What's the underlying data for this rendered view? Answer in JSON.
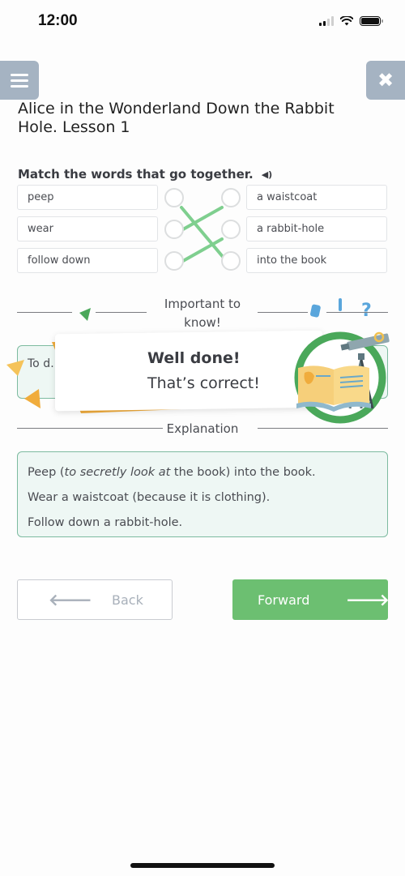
{
  "status_bar": {
    "time": "12:00",
    "signal_bars": "2 of 4",
    "icons": [
      "signal-icon",
      "wifi-icon",
      "battery-icon"
    ]
  },
  "header": {
    "menu_icon": "hamburger-menu-icon",
    "close_icon": "close-icon",
    "title": "Alice in the Wonderland Down the Rabbit Hole. Lesson 1"
  },
  "exercise": {
    "instruction": "Match the words that go together.",
    "audio_icon": "speaker-icon",
    "left_items": [
      "peep",
      "wear",
      "follow down"
    ],
    "right_items": [
      "a waistcoat",
      "a rabbit-hole",
      "into the book"
    ],
    "matches": [
      {
        "left": "peep",
        "right": "into the book"
      },
      {
        "left": "wear",
        "right": "a waistcoat"
      },
      {
        "left": "follow down",
        "right": "a rabbit-hole"
      }
    ],
    "line_color": "#7fcf8f"
  },
  "important": {
    "label": "Important to know!",
    "hint_text_visible": "To d… mean…"
  },
  "feedback": {
    "title": "Well done!",
    "subtitle": "That’s correct!",
    "ribbon_color": "#f0ac3c",
    "ring_color": "#4aa85a"
  },
  "explanation": {
    "label": "Explanation",
    "lines": [
      {
        "before": "Peep (",
        "italic": "to secretly look at",
        "after": " the book) into the book."
      },
      {
        "text": "Wear a waistcoat (because it is clothing)."
      },
      {
        "text": "Follow down a rabbit-hole."
      }
    ]
  },
  "navigation": {
    "back_label": "Back",
    "forward_label": "Forward",
    "back_icon": "arrow-left-icon",
    "forward_icon": "arrow-right-icon",
    "forward_color": "#6cbf71"
  }
}
